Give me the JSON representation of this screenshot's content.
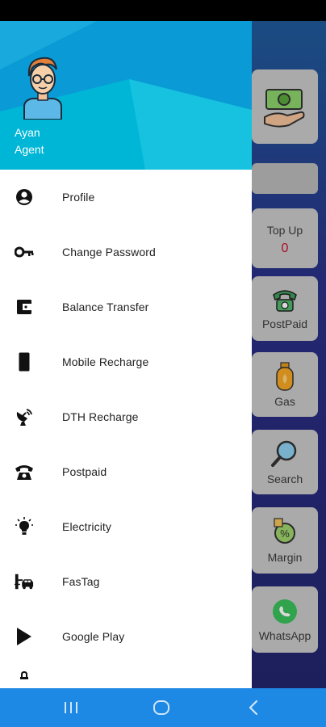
{
  "user": {
    "name": "Ayan",
    "role": "Agent"
  },
  "menu": [
    {
      "label": "Profile",
      "icon": "account-circle-icon"
    },
    {
      "label": "Change Password",
      "icon": "key-icon"
    },
    {
      "label": "Balance Transfer",
      "icon": "wallet-icon"
    },
    {
      "label": "Mobile Recharge",
      "icon": "mobile-phone-icon"
    },
    {
      "label": "DTH Recharge",
      "icon": "satellite-dish-icon"
    },
    {
      "label": "Postpaid",
      "icon": "telephone-icon"
    },
    {
      "label": "Electricity",
      "icon": "light-bulb-icon"
    },
    {
      "label": "FasTag",
      "icon": "toll-car-icon"
    },
    {
      "label": "Google Play",
      "icon": "play-icon"
    }
  ],
  "background_app": {
    "cards": [
      {
        "label": "Top Up",
        "value": "0"
      },
      {
        "label": "PostPaid"
      },
      {
        "label": "Gas"
      },
      {
        "label": "Search"
      },
      {
        "label": "Margin"
      },
      {
        "label": "WhatsApp"
      }
    ]
  },
  "colors": {
    "header_primary": "#00b6d6",
    "header_dark": "#0a9bd6",
    "nav_bar": "#1e88e5",
    "accent_value": "#c8102e"
  }
}
